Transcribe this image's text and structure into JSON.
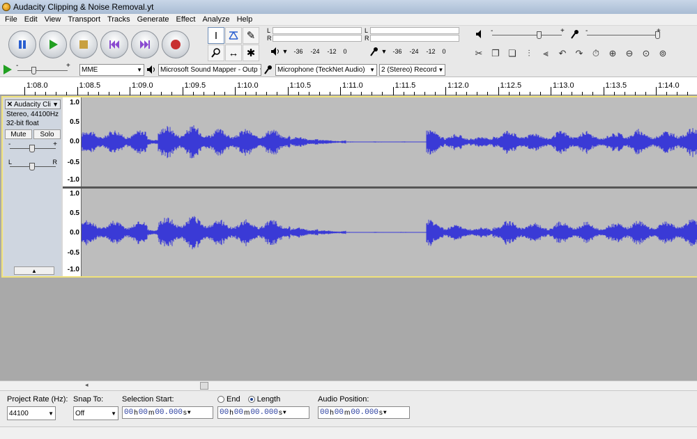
{
  "window": {
    "title": "Audacity Clipping & Noise Removal.yt"
  },
  "menu": [
    "File",
    "Edit",
    "View",
    "Transport",
    "Tracks",
    "Generate",
    "Effect",
    "Analyze",
    "Help"
  ],
  "transport_buttons": [
    "pause-button",
    "play-button",
    "stop-button",
    "skip-start-button",
    "skip-end-button",
    "record-button"
  ],
  "meters": {
    "playback": {
      "left_label": "L",
      "right_label": "R",
      "ticks": [
        "-36",
        "-24",
        "-12",
        "0"
      ]
    },
    "record": {
      "left_label": "L",
      "right_label": "R",
      "ticks": [
        "-36",
        "-24",
        "-12",
        "0"
      ]
    }
  },
  "mixer": {
    "playback_min": "-",
    "playback_max": "+",
    "record_min": "-",
    "record_max": "+"
  },
  "playat": {
    "min": "-",
    "max": "+"
  },
  "device": {
    "host": "MME",
    "output": "Microsoft Sound Mapper - Outp",
    "input": "Microphone (TeckNet Audio)",
    "channels": "2 (Stereo) Record"
  },
  "ruler": {
    "ticks": [
      {
        "t": 68.0,
        "label": "1:08.0"
      },
      {
        "t": 68.5,
        "label": "1:08.5"
      },
      {
        "t": 69.0,
        "label": "1:09.0"
      },
      {
        "t": 69.5,
        "label": "1:09.5"
      },
      {
        "t": 70.0,
        "label": "1:10.0"
      },
      {
        "t": 70.5,
        "label": "1:10.5"
      },
      {
        "t": 71.0,
        "label": "1:11.0"
      },
      {
        "t": 71.5,
        "label": "1:11.5"
      },
      {
        "t": 72.0,
        "label": "1:12.0"
      },
      {
        "t": 72.5,
        "label": "1:12.5"
      },
      {
        "t": 73.0,
        "label": "1:13.0"
      },
      {
        "t": 73.5,
        "label": "1:13.5"
      },
      {
        "t": 74.0,
        "label": "1:14.0"
      }
    ]
  },
  "track": {
    "name": "Audacity Cli",
    "format": "Stereo, 44100Hz",
    "bit_depth": "32-bit float",
    "mute_label": "Mute",
    "solo_label": "Solo",
    "gain_min": "-",
    "gain_max": "+",
    "pan_left": "L",
    "pan_right": "R",
    "scale": [
      "1.0",
      "0.5",
      "0.0",
      "-0.5",
      "-1.0"
    ]
  },
  "selection_bar": {
    "project_rate_label": "Project Rate (Hz):",
    "project_rate_value": "44100",
    "snap_label": "Snap To:",
    "snap_value": "Off",
    "selection_start_label": "Selection Start:",
    "end_label": "End",
    "length_label": "Length",
    "audio_position_label": "Audio Position:",
    "time_h": "00",
    "time_m": "00",
    "time_s": "00.000",
    "unit_h": "h",
    "unit_m": "m",
    "unit_s": "s"
  },
  "colors": {
    "waveform": "#3a3ad6",
    "selection_border": "#f0e27a",
    "track_bg": "#bdbdbd"
  }
}
